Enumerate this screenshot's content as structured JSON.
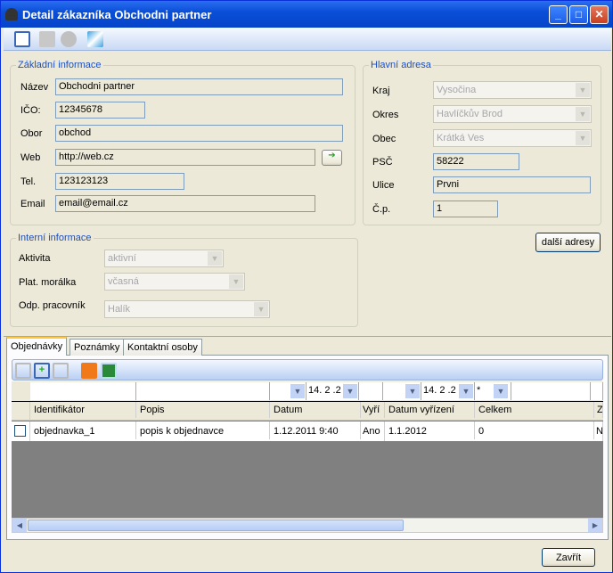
{
  "window": {
    "title": "Detail zákazníka Obchodni partner",
    "min": "_",
    "max": "□",
    "close": "✕"
  },
  "toolbar": {
    "icons": [
      "edit-icon",
      "save-icon",
      "cancel-icon",
      "chart-icon"
    ]
  },
  "basic": {
    "legend": "Základní informace",
    "name_label": "Název",
    "name": "Obchodni partner",
    "ico_label": "IČO:",
    "ico": "12345678",
    "obor_label": "Obor",
    "obor": "obchod",
    "web_label": "Web",
    "web": "http://web.cz",
    "web_go": "➔",
    "tel_label": "Tel.",
    "tel": "123123123",
    "email_label": "Email",
    "email": "email@email.cz"
  },
  "address": {
    "legend": "Hlavní adresa",
    "kraj_label": "Kraj",
    "kraj": "Vysočina",
    "okres_label": "Okres",
    "okres": "Havlíčkův Brod",
    "obec_label": "Obec",
    "obec": "Krátká Ves",
    "psc_label": "PSČ",
    "psc": "58222",
    "ulice_label": "Ulice",
    "ulice": "Prvni",
    "cp_label": "Č.p.",
    "cp": "1",
    "more_button": "další adresy"
  },
  "internal": {
    "legend": "Interní informace",
    "aktivita_label": "Aktivita",
    "aktivita": "aktivní",
    "moralka_label": "Plat. morálka",
    "moralka": "včasná",
    "pracovnik_label": "Odp. pracovník",
    "pracovnik": "Halík"
  },
  "tabs": [
    "Objednávky",
    "Poznámky",
    "Kontaktní osoby"
  ],
  "grid": {
    "filters": {
      "date1": "14. 2 .2",
      "date2": "14. 2 .2",
      "celkem_op": "*"
    },
    "columns": [
      "Identifikátor",
      "Popis",
      "Datum",
      "Vyří",
      "Datum vyřízení",
      "Celkem",
      "Z"
    ],
    "rows": [
      [
        "objednavka_1",
        "popis k objednavce",
        "1.12.2011 9:40",
        "Ano",
        "1.1.2012",
        "0",
        "Ne"
      ]
    ]
  },
  "footer": {
    "close_button": "Zavřít"
  }
}
